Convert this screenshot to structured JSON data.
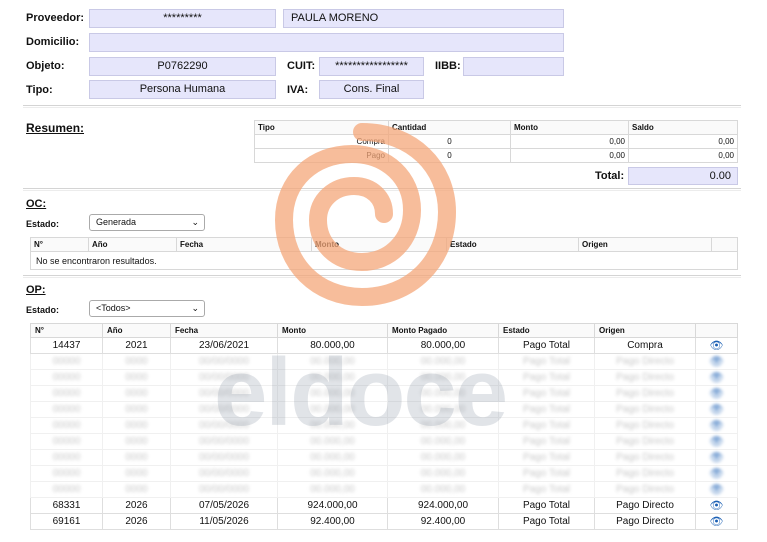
{
  "form": {
    "proveedor_label": "Proveedor:",
    "proveedor_code": "*********",
    "proveedor_name": "PAULA MORENO",
    "domicilio_label": "Domicilio:",
    "domicilio_value": "",
    "objeto_label": "Objeto:",
    "objeto_value": "P0762290",
    "cuit_label": "CUIT:",
    "cuit_value": "*****************",
    "iibb_label": "IIBB:",
    "iibb_value": "",
    "tipo_label": "Tipo:",
    "tipo_value": "Persona Humana",
    "iva_label": "IVA:",
    "iva_value": "Cons. Final"
  },
  "resumen": {
    "title": "Resumen:",
    "headers": [
      "Tipo",
      "Cantidad",
      "Monto",
      "Saldo"
    ],
    "rows": [
      {
        "tipo": "Compra",
        "cantidad": "0",
        "monto": "0,00",
        "saldo": "0,00"
      },
      {
        "tipo": "Pago",
        "cantidad": "0",
        "monto": "0,00",
        "saldo": "0,00"
      }
    ],
    "total_label": "Total:",
    "total_value": "0.00"
  },
  "oc": {
    "title": "OC:",
    "estado_label": "Estado:",
    "estado_value": "Generada",
    "headers": [
      "N°",
      "Año",
      "Fecha",
      "Monto",
      "Estado",
      "Origen"
    ],
    "empty_message": "No se encontraron resultados."
  },
  "op": {
    "title": "OP:",
    "estado_label": "Estado:",
    "estado_value": "<Todos>",
    "headers": [
      "N°",
      "Año",
      "Fecha",
      "Monto",
      "Monto Pagado",
      "Estado",
      "Origen"
    ],
    "rows": [
      {
        "n": "14437",
        "anio": "2021",
        "fecha": "23/06/2021",
        "monto": "80.000,00",
        "pagado": "80.000,00",
        "estado": "Pago Total",
        "origen": "Compra"
      },
      {
        "n": "68331",
        "anio": "2026",
        "fecha": "07/05/2026",
        "monto": "924.000,00",
        "pagado": "924.000,00",
        "estado": "Pago Total",
        "origen": "Pago Directo"
      },
      {
        "n": "69161",
        "anio": "2026",
        "fecha": "11/05/2026",
        "monto": "92.400,00",
        "pagado": "92.400,00",
        "estado": "Pago Total",
        "origen": "Pago Directo"
      }
    ]
  },
  "icons": {
    "view": "eye-icon",
    "dropdown": "chevron-down-icon"
  },
  "watermark": {
    "text": "eldoce",
    "color": "#f4a77a"
  }
}
